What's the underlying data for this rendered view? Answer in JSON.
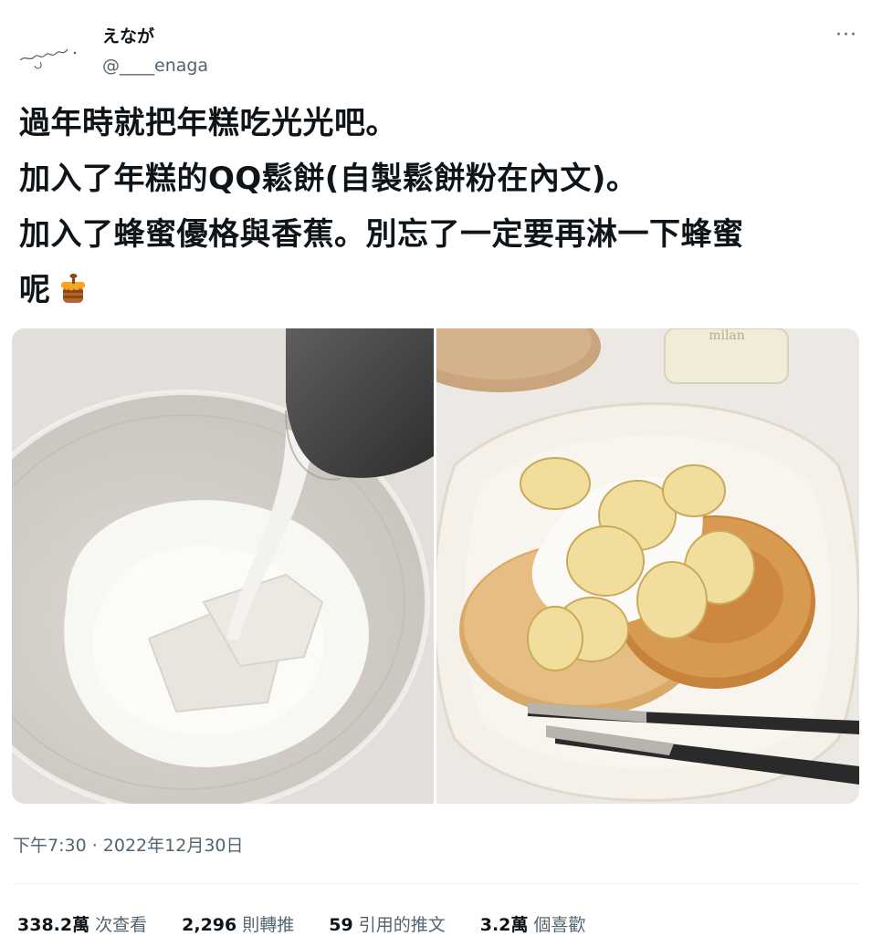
{
  "author": {
    "display_name": "えなが",
    "handle": "@____enaga",
    "avatar_signature": "enaga."
  },
  "more_icon": "···",
  "tweet": {
    "lines": [
      "過年時就把年糕吃光光吧。",
      "加入了年糕的QQ鬆餅(自製鬆餅粉在內文)。",
      "加入了蜂蜜優格與香蕉。別忘了一定要再淋一下蜂蜜",
      "呢"
    ],
    "emoji": "honey-pot-icon"
  },
  "media": {
    "left": "yogurt-bowl-photo",
    "right": "pancake-photo",
    "jar_label": "milan"
  },
  "timestamp": "下午7:30 · 2022年12月30日",
  "stats": [
    {
      "num": "338.2萬",
      "label": "次查看"
    },
    {
      "num": "2,296",
      "label": "則轉推"
    },
    {
      "num": "59",
      "label": "引用的推文"
    },
    {
      "num": "3.2萬",
      "label": "個喜歡"
    }
  ]
}
